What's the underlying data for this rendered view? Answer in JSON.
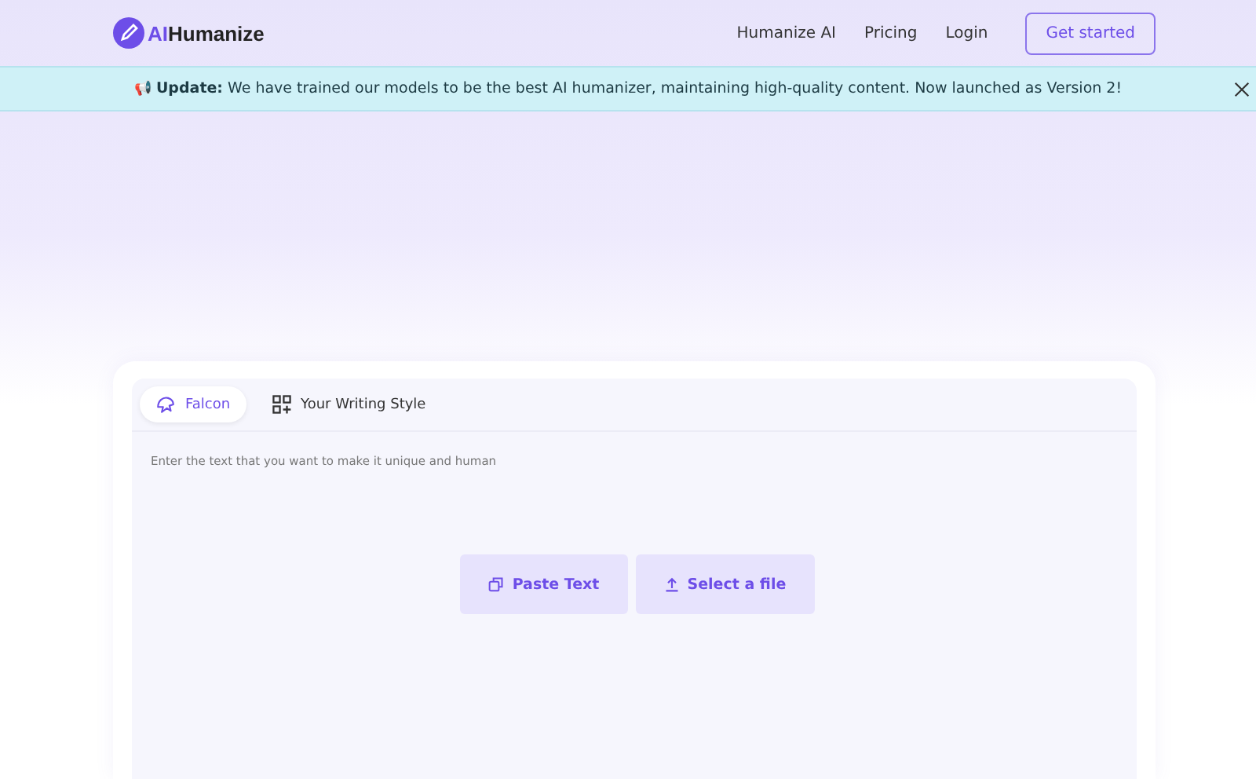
{
  "header": {
    "logo": {
      "prefix": "AI",
      "name": "Humanize"
    },
    "nav": [
      {
        "label": "Humanize AI"
      },
      {
        "label": "Pricing"
      },
      {
        "label": "Login"
      }
    ],
    "cta": "Get started"
  },
  "announcement": {
    "icon": "📢",
    "text": "**Update:** We have trained our models to be the best AI humanizer, maintaining high-quality content. Now launched as Version 2!"
  },
  "editor": {
    "tabs": [
      {
        "label": "Falcon",
        "kind": "falcon",
        "selected": true
      },
      {
        "label": "Your Writing Style",
        "kind": "style",
        "selected": false
      }
    ],
    "placeholder": "Enter the text that you want to make it unique and human",
    "actions": [
      {
        "label": "Paste Text",
        "kind": "paste"
      },
      {
        "label": "Select a file",
        "kind": "upload"
      }
    ]
  }
}
